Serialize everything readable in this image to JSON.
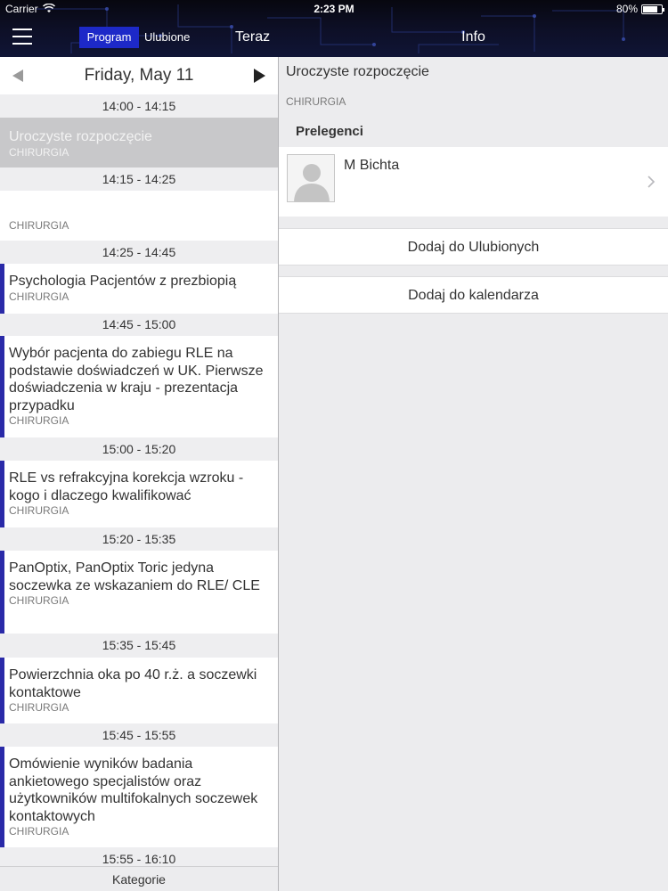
{
  "status_bar": {
    "carrier": "Carrier",
    "time": "2:23 PM",
    "battery": "80%"
  },
  "nav": {
    "tab_program": "Program",
    "tab_ulubione": "Ulubione",
    "tab_teraz": "Teraz",
    "info_title": "Info"
  },
  "day": {
    "label": "Friday, May 11"
  },
  "schedule": [
    {
      "time": "14:00 - 14:15",
      "title": "Uroczyste rozpoczęcie",
      "track": "CHIRURGIA"
    },
    {
      "time": "14:15 - 14:25",
      "title": "",
      "track": "CHIRURGIA"
    },
    {
      "time": "14:25 - 14:45",
      "title": "Psychologia Pacjentów z prezbiopią",
      "track": "CHIRURGIA"
    },
    {
      "time": "14:45 - 15:00",
      "title": "Wybór pacjenta do zabiegu RLE na podstawie doświadczeń w UK. Pierwsze doświadczenia w kraju - prezentacja przypadku",
      "track": "CHIRURGIA"
    },
    {
      "time": "15:00 - 15:20",
      "title": "RLE vs refrakcyjna korekcja wzroku - kogo i dlaczego kwalifikować",
      "track": "CHIRURGIA"
    },
    {
      "time": "15:20 - 15:35",
      "title": "PanOptix, PanOptix Toric jedyna soczewka ze wskazaniem do RLE/ CLE",
      "track": "CHIRURGIA"
    },
    {
      "time": "15:35 - 15:45",
      "title": "Powierzchnia oka po 40 r.ż. a soczewki kontaktowe",
      "track": "CHIRURGIA"
    },
    {
      "time": "15:45 - 15:55",
      "title": "Omówienie wyników badania ankietowego specjalistów oraz użytkowników multifokalnych soczewek kontaktowych",
      "track": "CHIRURGIA"
    },
    {
      "time": "15:55 - 16:10"
    }
  ],
  "footer": {
    "kategorie": "Kategorie"
  },
  "detail": {
    "title": "Uroczyste rozpoczęcie",
    "track": "CHIRURGIA",
    "speakers_heading": "Prelegenci",
    "speaker_name": "M Bichta",
    "add_favorites": "Dodaj do Ulubionych",
    "add_calendar": "Dodaj do kalendarza"
  }
}
